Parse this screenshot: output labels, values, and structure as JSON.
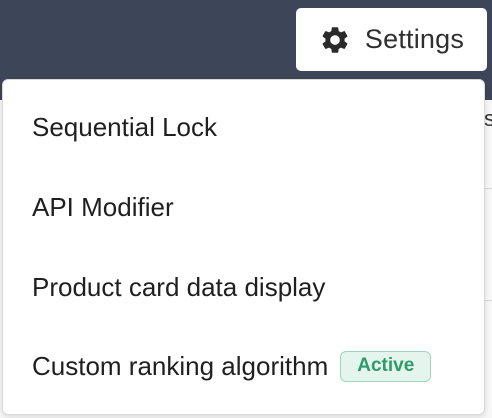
{
  "header": {
    "settings_button": {
      "icon": "gear-icon",
      "label": "Settings"
    }
  },
  "background": {
    "stub_text": "s"
  },
  "menu": {
    "items": [
      {
        "label": "Sequential Lock"
      },
      {
        "label": "API Modifier"
      },
      {
        "label": "Product card data display"
      },
      {
        "label": "Custom ranking algorithm",
        "badge": "Active"
      }
    ]
  },
  "colors": {
    "top_bar": "#3c4658",
    "badge_text": "#2f9b6b",
    "badge_bg": "#e4f5ee"
  }
}
